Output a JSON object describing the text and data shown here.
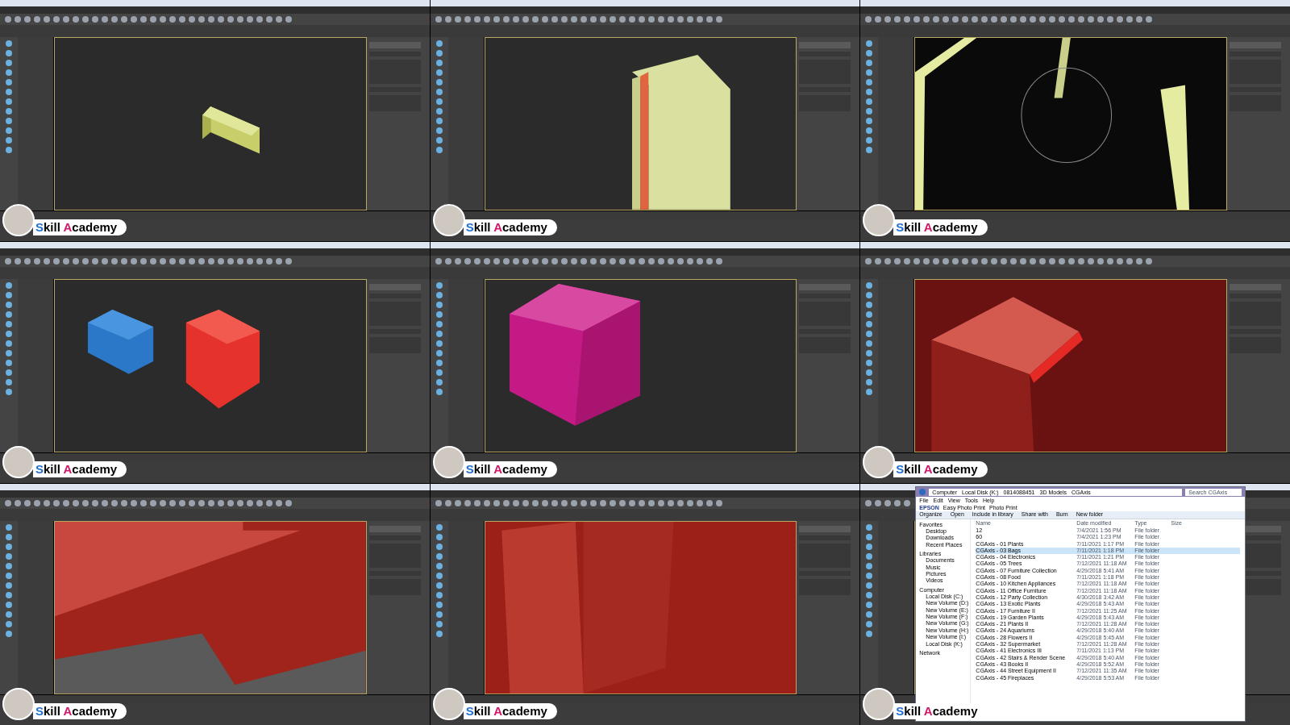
{
  "tiles": [
    {
      "kind": "beam",
      "logo": "Skill Academy"
    },
    {
      "kind": "wall",
      "logo": "Skill Academy"
    },
    {
      "kind": "room",
      "logo": "Skill Academy"
    },
    {
      "kind": "boxes",
      "logo": "Skill Academy"
    },
    {
      "kind": "cube",
      "logo": "Skill Academy"
    },
    {
      "kind": "ledge",
      "logo": "Skill Academy"
    },
    {
      "kind": "plane",
      "logo": "Skill Academy"
    },
    {
      "kind": "corner",
      "logo": "Skill Academy"
    },
    {
      "kind": "explorer",
      "logo": "Skill Academy"
    }
  ],
  "explorer": {
    "path": [
      "Computer",
      "Local Disk (K:)",
      "0814088451",
      "3D Models",
      "CGAxis"
    ],
    "search": "Search CGAxis",
    "menus": [
      "File",
      "Edit",
      "View",
      "Tools",
      "Help"
    ],
    "epson": [
      "EPSON",
      "Easy Photo Print",
      "Photo Print"
    ],
    "commands": [
      "Organize",
      "Open",
      "Include in library",
      "Share with",
      "Burn",
      "New folder"
    ],
    "nav": [
      {
        "label": "Favorites",
        "children": [
          {
            "label": "Desktop"
          },
          {
            "label": "Downloads"
          },
          {
            "label": "Recent Places"
          }
        ]
      },
      {
        "label": "Libraries",
        "children": [
          {
            "label": "Documents"
          },
          {
            "label": "Music"
          },
          {
            "label": "Pictures"
          },
          {
            "label": "Videos"
          }
        ]
      },
      {
        "label": "Computer",
        "children": [
          {
            "label": "Local Disk (C:)"
          },
          {
            "label": "New Volume (D:)"
          },
          {
            "label": "New Volume (E:)"
          },
          {
            "label": "New Volume (F:)"
          },
          {
            "label": "New Volume (G:)"
          },
          {
            "label": "New Volume (H:)"
          },
          {
            "label": "New Volume (I:)"
          },
          {
            "label": "Local Disk (K:)"
          }
        ]
      },
      {
        "label": "Network"
      }
    ],
    "columns": [
      "Name",
      "Date modified",
      "Type",
      "Size"
    ],
    "rows": [
      {
        "name": "12",
        "date": "7/4/2021 1:56 PM",
        "type": "File folder",
        "selected": false
      },
      {
        "name": "60",
        "date": "7/4/2021 1:23 PM",
        "type": "File folder",
        "selected": false
      },
      {
        "name": "CGAxis - 01 Plants",
        "date": "7/11/2021 1:17 PM",
        "type": "File folder",
        "selected": false
      },
      {
        "name": "CGAxis - 03 Bags",
        "date": "7/11/2021 1:18 PM",
        "type": "File folder",
        "selected": true
      },
      {
        "name": "CGAxis - 04 Electronics",
        "date": "7/11/2021 1:21 PM",
        "type": "File folder",
        "selected": false
      },
      {
        "name": "CGAxis - 05 Trees",
        "date": "7/12/2021 11:18 AM",
        "type": "File folder",
        "selected": false
      },
      {
        "name": "CGAxis - 07 Furniture Collection",
        "date": "4/29/2018 5:41 AM",
        "type": "File folder",
        "selected": false
      },
      {
        "name": "CGAxis - 08 Food",
        "date": "7/11/2021 1:18 PM",
        "type": "File folder",
        "selected": false
      },
      {
        "name": "CGAxis - 10 Kitchen Appliances",
        "date": "7/12/2021 11:18 AM",
        "type": "File folder",
        "selected": false
      },
      {
        "name": "CGAxis - 11 Office Furniture",
        "date": "7/12/2021 11:18 AM",
        "type": "File folder",
        "selected": false
      },
      {
        "name": "CGAxis - 12 Party Collection",
        "date": "4/30/2018 3:42 AM",
        "type": "File folder",
        "selected": false
      },
      {
        "name": "CGAxis - 13 Exotic Plants",
        "date": "4/29/2018 5:43 AM",
        "type": "File folder",
        "selected": false
      },
      {
        "name": "CGAxis - 17 Furniture II",
        "date": "7/12/2021 11:25 AM",
        "type": "File folder",
        "selected": false
      },
      {
        "name": "CGAxis - 19 Garden Plants",
        "date": "4/29/2018 5:43 AM",
        "type": "File folder",
        "selected": false
      },
      {
        "name": "CGAxis - 21 Plants II",
        "date": "7/12/2021 11:28 AM",
        "type": "File folder",
        "selected": false
      },
      {
        "name": "CGAxis - 24 Aquariums",
        "date": "4/29/2018 5:40 AM",
        "type": "File folder",
        "selected": false
      },
      {
        "name": "CGAxis - 28 Flowers II",
        "date": "4/29/2018 5:45 AM",
        "type": "File folder",
        "selected": false
      },
      {
        "name": "CGAxis - 32 Supermarket",
        "date": "7/12/2021 11:28 AM",
        "type": "File folder",
        "selected": false
      },
      {
        "name": "CGAxis - 41 Electronics III",
        "date": "7/11/2021 1:13 PM",
        "type": "File folder",
        "selected": false
      },
      {
        "name": "CGAxis - 42 Stairs & Render Scene",
        "date": "4/29/2018 5:40 AM",
        "type": "File folder",
        "selected": false
      },
      {
        "name": "CGAxis - 43 Books II",
        "date": "4/29/2018 5:52 AM",
        "type": "File folder",
        "selected": false
      },
      {
        "name": "CGAxis - 44 Street Equipment II",
        "date": "7/12/2021 11:35 AM",
        "type": "File folder",
        "selected": false
      },
      {
        "name": "CGAxis - 45 Fireplaces",
        "date": "4/29/2018 5:53 AM",
        "type": "File folder",
        "selected": false
      }
    ]
  }
}
